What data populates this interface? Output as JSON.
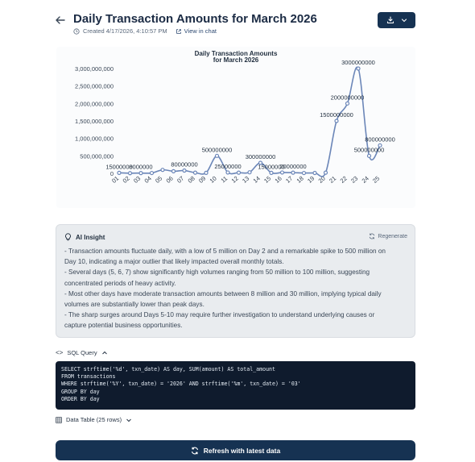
{
  "header": {
    "title": "Daily Transaction Amounts for March 2026",
    "created": "Created 4/17/2026, 4:10:57 PM",
    "view_in_chat": "View in chat"
  },
  "colors": {
    "primary": "#163252",
    "line": "#6b86b8",
    "panel": "#e9ecef"
  },
  "chart_data": {
    "type": "line",
    "title": "Daily Transaction Amounts\nfor March 2026",
    "title_line1": "Daily Transaction Amounts",
    "title_line2": "for March 2026",
    "x": [
      "01",
      "02",
      "03",
      "04",
      "05",
      "06",
      "07",
      "08",
      "09",
      "10",
      "11",
      "12",
      "13",
      "14",
      "15",
      "16",
      "17",
      "18",
      "19",
      "20",
      "21",
      "22",
      "23",
      "24",
      "25"
    ],
    "y_ticks": [
      0,
      500000000,
      1000000000,
      1500000000,
      2000000000,
      2500000000,
      3000000000
    ],
    "y_tick_labels": [
      "0",
      "500,000,000",
      "1,000,000,000",
      "1,500,000,000",
      "2,000,000,000",
      "2,500,000,000",
      "3,000,000,000"
    ],
    "ylim": [
      0,
      3000000000
    ],
    "series": [
      {
        "values": [
          15000000,
          5000000,
          8000000,
          10000000,
          100000000,
          60000000,
          80000000,
          20000000,
          15000000,
          500000000,
          25000000,
          20000000,
          30000000,
          300000000,
          15000000,
          25000000,
          20000000,
          10000000,
          12000000,
          20000000,
          1500000000,
          2000000000,
          3000000000,
          500000000,
          800000000
        ]
      }
    ],
    "data_labels": [
      {
        "index": 0,
        "text": "15000000"
      },
      {
        "index": 2,
        "text": "8000000"
      },
      {
        "index": 6,
        "text": "80000000"
      },
      {
        "index": 9,
        "text": "500000000"
      },
      {
        "index": 10,
        "text": "25000000"
      },
      {
        "index": 13,
        "text": "300000000"
      },
      {
        "index": 14,
        "text": "15000000"
      },
      {
        "index": 16,
        "text": "20000000"
      },
      {
        "index": 20,
        "text": "1500000000"
      },
      {
        "index": 21,
        "text": "2000000000"
      },
      {
        "index": 22,
        "text": "3000000000"
      },
      {
        "index": 23,
        "text": "500000000"
      },
      {
        "index": 24,
        "text": "800000000"
      }
    ],
    "grid": false
  },
  "insight": {
    "title": "AI Insight",
    "regenerate": "Regenerate",
    "lines": [
      "- Transaction amounts fluctuate daily, with a low of 5 million on Day 2 and a remarkable spike to 500 million on",
      "Day 10, indicating a major outlier that likely impacted overall monthly totals.",
      "- Several days (5, 6, 7) show significantly high volumes ranging from 50 million to 100 million, suggesting",
      "concentrated periods of heavy activity.",
      "- Most other days have moderate transaction amounts between 8 million and 30 million, implying typical daily",
      "volumes are substantially lower than peak days.",
      "- The sharp surges around Days 5-10 may require further investigation to understand underlying causes or",
      "capture potential business opportunities."
    ]
  },
  "sql": {
    "toggle_label": "SQL Query",
    "lines": [
      "SELECT strftime('%d', txn_date) AS day, SUM(amount) AS total_amount",
      "FROM transactions",
      "WHERE strftime('%Y', txn_date) = '2026' AND strftime('%m', txn_date) = '03'",
      "GROUP BY day",
      "ORDER BY day"
    ]
  },
  "table": {
    "toggle_label": "Data Table (25 rows)"
  },
  "refresh": {
    "label": "Refresh with latest data"
  }
}
